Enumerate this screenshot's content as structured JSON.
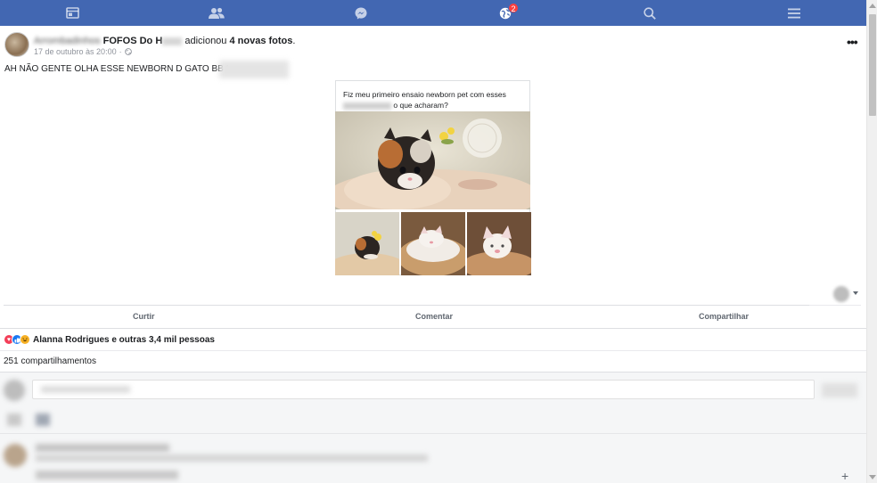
{
  "topbar": {
    "items": [
      {
        "name": "news-feed-icon"
      },
      {
        "name": "friends-icon"
      },
      {
        "name": "messenger-icon"
      },
      {
        "name": "notifications-icon",
        "badge": "2"
      },
      {
        "name": "search-icon"
      },
      {
        "name": "menu-icon"
      }
    ],
    "background": "#4267b2"
  },
  "post": {
    "author_blurred": "Arrombadinhos",
    "author_visible": "FOFOS Do H",
    "action_text": "adicionou",
    "photo_count_text": "4 novas fotos",
    "date": "17 de outubro às 20:00",
    "caption": "AH NÃO GENTE OLHA ESSE NEWBORN D GATO BB I",
    "shared_card": {
      "text_line1": "Fiz meu primeiro ensaio newborn pet com esses",
      "text_line2_end": "o que acharam?"
    }
  },
  "actions": {
    "like": "Curtir",
    "comment": "Comentar",
    "share": "Compartilhar"
  },
  "reactions": {
    "summary": "Alanna Rodrigues e outras 3,4 mil pessoas",
    "types": [
      "love",
      "like",
      "haha"
    ]
  },
  "shares": "251 compartilhamentos",
  "colors": {
    "accent": "#4267b2",
    "badge": "#fa3e3e",
    "love": "#f33e58",
    "like": "#1877f2",
    "haha": "#f7b125"
  }
}
